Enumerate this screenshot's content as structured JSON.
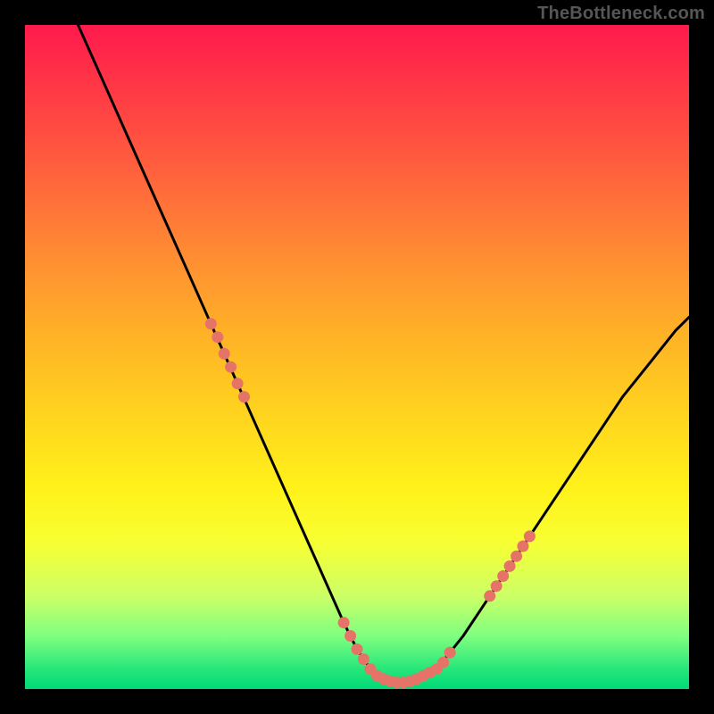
{
  "watermark": "TheBottleneck.com",
  "colors": {
    "background": "#000000",
    "curve": "#000000",
    "marker": "#e57368",
    "gradient_stops": [
      "#ff1a4d",
      "#ff3346",
      "#ff5a3f",
      "#ff8a33",
      "#ffb027",
      "#ffd21f",
      "#fff21a",
      "#f7ff33",
      "#ccff66",
      "#80ff80",
      "#26e67a",
      "#00d977"
    ]
  },
  "chart_data": {
    "type": "line",
    "title": "",
    "xlabel": "",
    "ylabel": "",
    "xlim": [
      0,
      100
    ],
    "ylim": [
      0,
      100
    ],
    "series": [
      {
        "name": "bottleneck-curve",
        "x": [
          8,
          12,
          16,
          20,
          24,
          28,
          32,
          36,
          40,
          44,
          48,
          50,
          52,
          54,
          56,
          58,
          60,
          62,
          66,
          70,
          74,
          78,
          82,
          86,
          90,
          94,
          98,
          100
        ],
        "y": [
          100,
          91,
          82,
          73,
          64,
          55,
          46,
          37,
          28,
          19,
          10,
          6,
          3,
          1.5,
          1,
          1,
          1.5,
          3,
          8,
          14,
          20,
          26,
          32,
          38,
          44,
          49,
          54,
          56
        ]
      }
    ],
    "markers": {
      "name": "highlighted-points",
      "x": [
        28,
        29,
        30,
        31,
        32,
        33,
        48,
        49,
        50,
        51,
        52,
        53,
        54,
        55,
        56,
        57,
        58,
        59,
        60,
        61,
        62,
        63,
        64,
        70,
        71,
        72,
        73,
        74,
        75,
        76
      ],
      "y": [
        55,
        53,
        50.5,
        48.5,
        46,
        44,
        10,
        8,
        6,
        4.5,
        3,
        2,
        1.5,
        1.2,
        1,
        1,
        1.2,
        1.5,
        2,
        2.5,
        3,
        4,
        5.5,
        14,
        15.5,
        17,
        18.5,
        20,
        21.5,
        23
      ]
    }
  }
}
